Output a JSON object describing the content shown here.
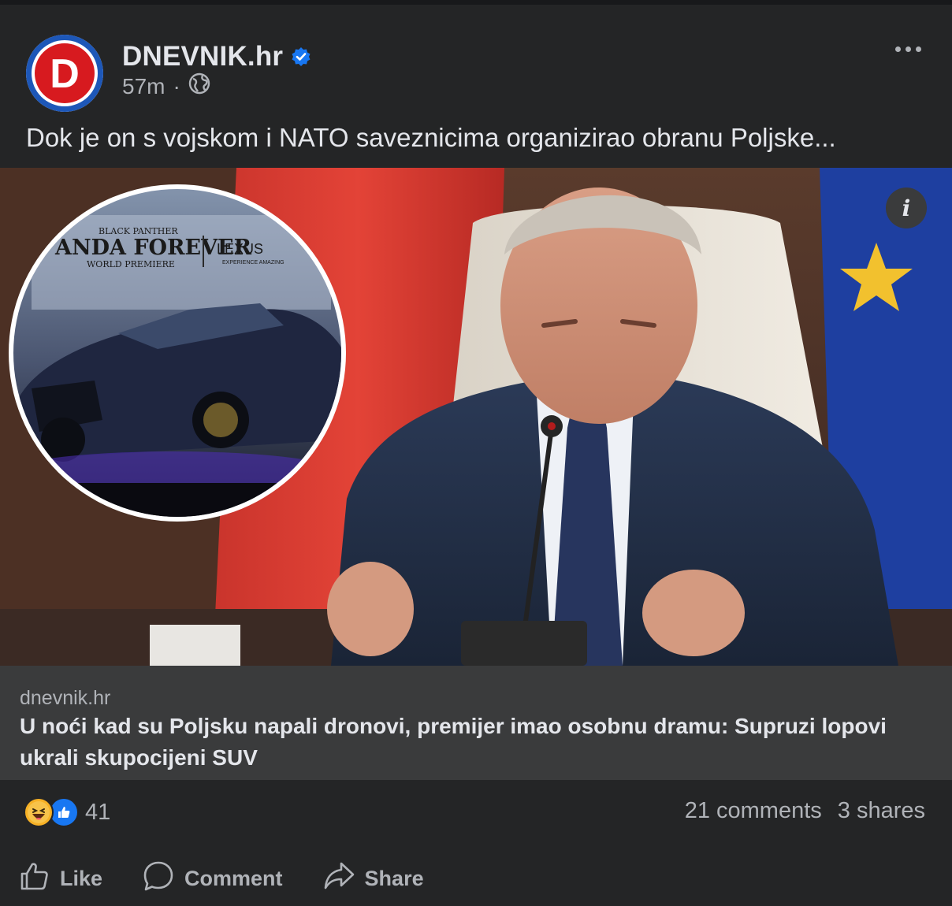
{
  "post": {
    "page_name": "DNEVNIK.hr",
    "time": "57m",
    "separator": "·",
    "text": "Dok je on s vojskom i NATO saveznicima organizirao obranu Poljske...",
    "avatar_letter": "D"
  },
  "image": {
    "inset_banner_small": "BLACK PANTHER",
    "inset_banner_big": "ANDA FOREVER",
    "inset_banner_sub": "WORLD PREMIERE",
    "inset_brand": "LEXUS",
    "inset_brand_sub": "EXPERIENCE AMAZING",
    "info_label": "i"
  },
  "link": {
    "domain": "dnevnik.hr",
    "title": "U noći kad su Poljsku napali dronovi, premijer imao osobnu dramu: Supruzi lopovi ukrali skupocijeni SUV"
  },
  "engagement": {
    "reaction_count": "41",
    "comments": "21 comments",
    "shares": "3 shares"
  },
  "actions": {
    "like": "Like",
    "comment": "Comment",
    "share": "Share"
  },
  "colors": {
    "brand_red": "#d71a1f",
    "brand_blue": "#1d57b8",
    "verified_blue": "#1877f2",
    "card_bg": "#242526",
    "link_bg": "#3a3b3c"
  }
}
